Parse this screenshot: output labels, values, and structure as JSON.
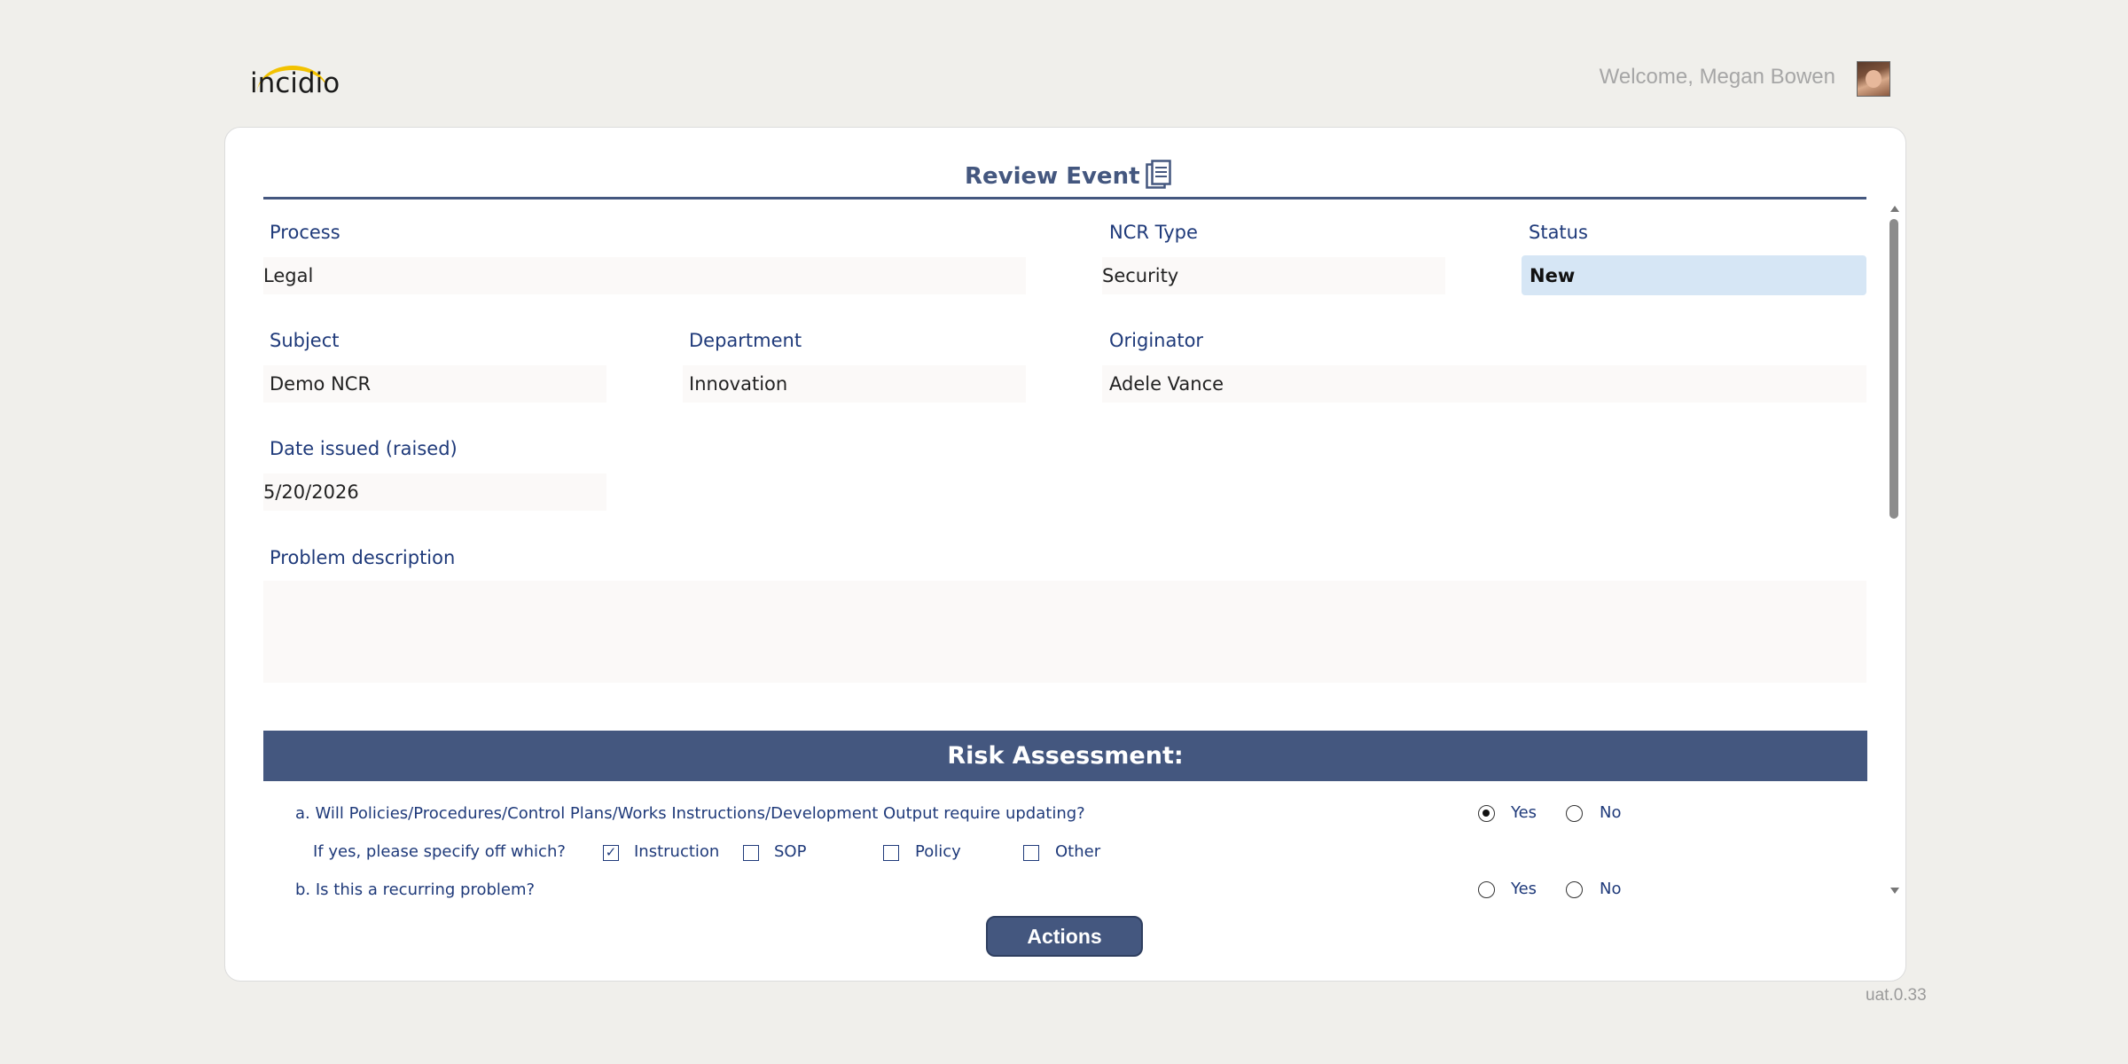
{
  "header": {
    "logo_text": "incidio",
    "welcome": "Welcome, Megan Bowen"
  },
  "form": {
    "title": "Review Event",
    "process": {
      "label": "Process",
      "value": "Legal"
    },
    "ncr_type": {
      "label": "NCR Type",
      "value": "Security"
    },
    "status": {
      "label": "Status",
      "value": "New"
    },
    "subject": {
      "label": "Subject",
      "value": "Demo NCR"
    },
    "department": {
      "label": "Department",
      "value": "Innovation"
    },
    "originator": {
      "label": "Originator",
      "value": "Adele Vance"
    },
    "date_issued": {
      "label": "Date issued (raised)",
      "value": "5/20/2026"
    },
    "problem_description": {
      "label": "Problem description",
      "value": ""
    }
  },
  "risk": {
    "heading": "Risk Assessment:",
    "q_a": "a. Will Policies/Procedures/Control Plans/Works Instructions/Development Output require updating?",
    "q_a_specify": "If yes, please specify off which?",
    "q_a_options": [
      "Instruction",
      "SOP",
      "Policy",
      "Other"
    ],
    "q_a_checked": [
      "Instruction"
    ],
    "q_a_answer": "Yes",
    "q_b": "b. Is this a recurring problem?",
    "q_b_answer": "",
    "yes_label": "Yes",
    "no_label": "No"
  },
  "actions_label": "Actions",
  "version": "uat.0.33",
  "colors": {
    "accent": "#44577f",
    "label": "#1f3a7a",
    "status_bg": "#d6e6f5",
    "logo_arc": "#f2c200"
  },
  "icons": {
    "title": "document-icon"
  }
}
